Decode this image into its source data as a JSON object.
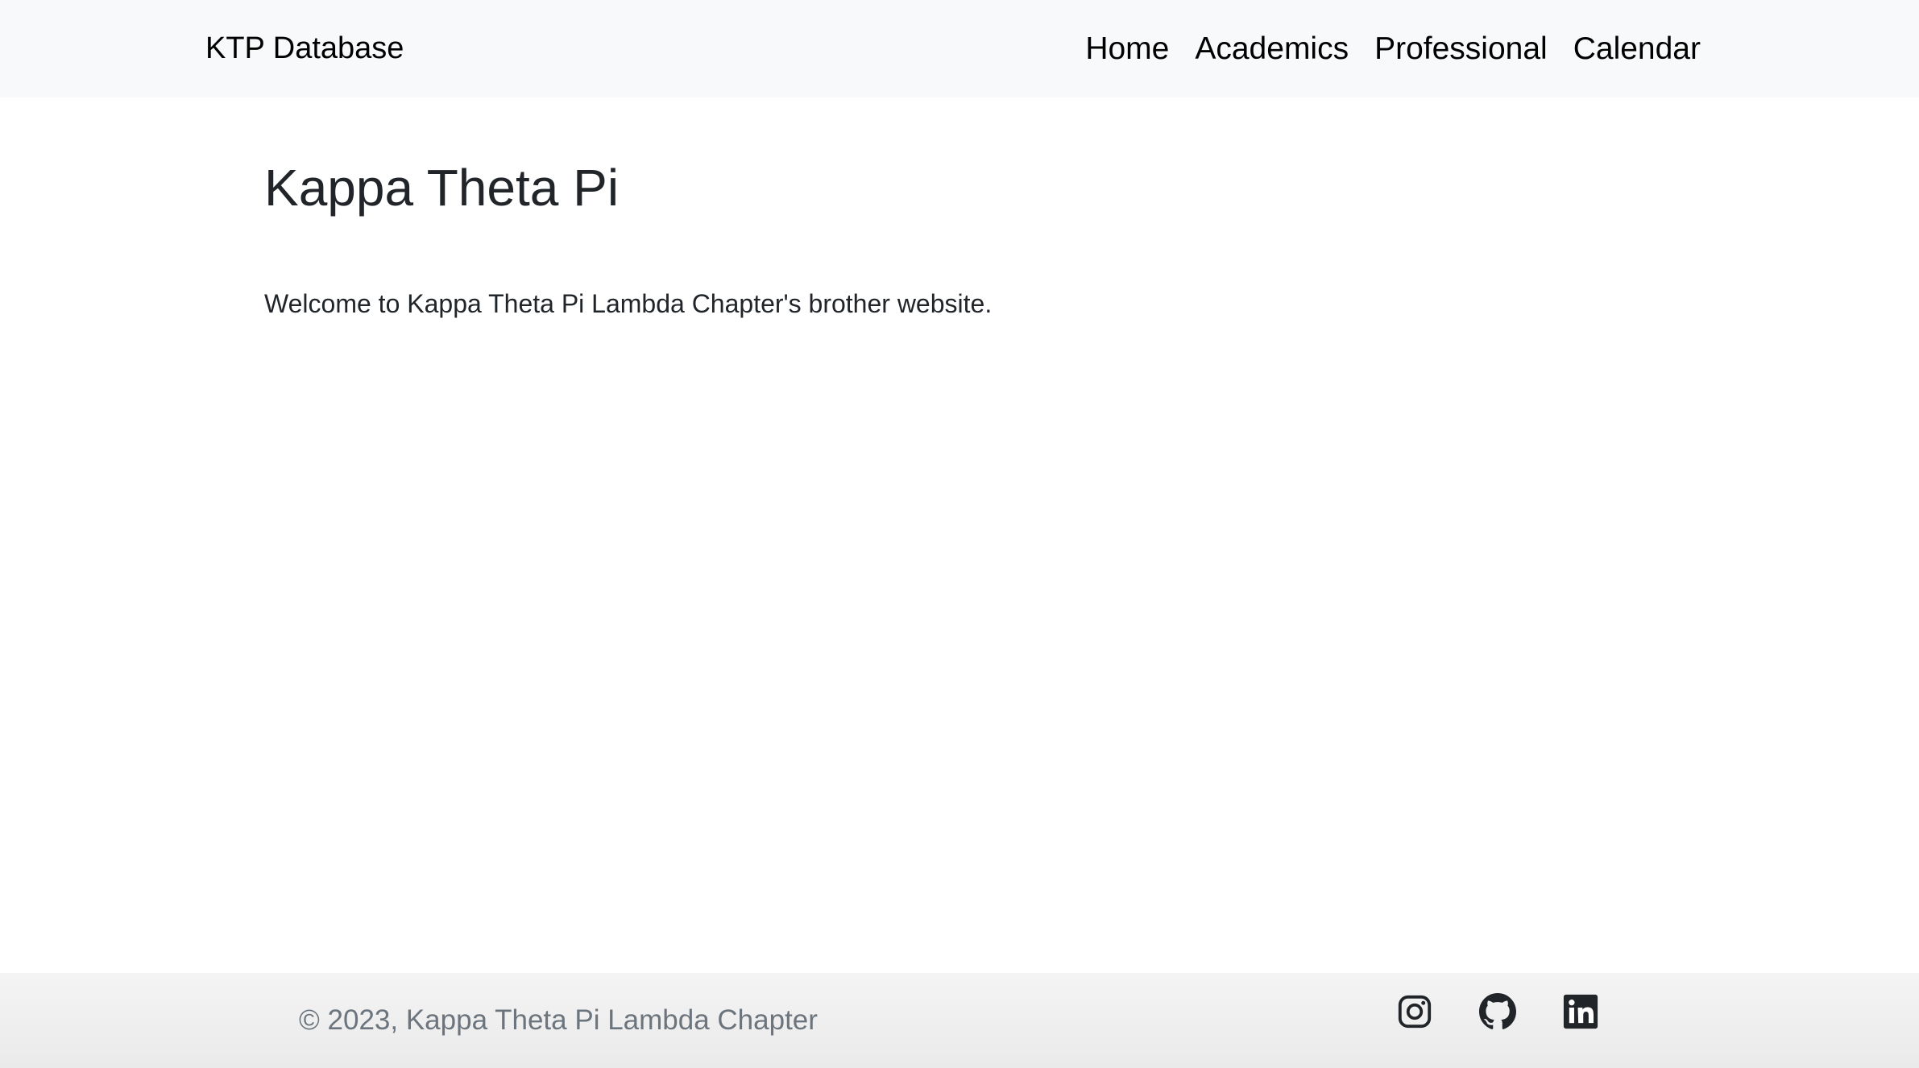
{
  "navbar": {
    "brand": "KTP Database",
    "links": [
      "Home",
      "Academics",
      "Professional",
      "Calendar"
    ]
  },
  "main": {
    "title": "Kappa Theta Pi",
    "welcome": "Welcome to Kappa Theta Pi Lambda Chapter's brother website."
  },
  "footer": {
    "copyright": "© 2023, Kappa Theta Pi Lambda Chapter",
    "social_icons": [
      "instagram-icon",
      "github-icon",
      "linkedin-icon"
    ]
  },
  "colors": {
    "navbar_bg": "#f8f9fa",
    "footer_bg": "#efefef",
    "text": "#212529",
    "muted_text": "#6c757d",
    "icon": "#212529"
  }
}
